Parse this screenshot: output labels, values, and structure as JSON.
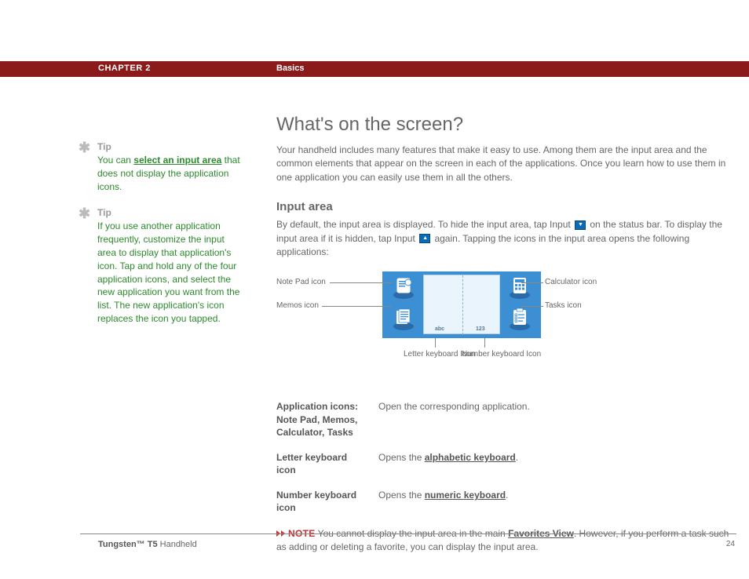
{
  "header": {
    "chapter": "CHAPTER 2",
    "section": "Basics"
  },
  "sidebar": {
    "tips": [
      {
        "label": "Tip",
        "pre": "You can ",
        "link": "select an input area",
        "post": " that does not display the application icons."
      },
      {
        "label": "Tip",
        "pre": "If you use another application frequently, customize the input area to display that application's icon. Tap and hold any of the four application icons, and select the new application you want from the list. The new application's icon replaces the icon you tapped.",
        "link": "",
        "post": ""
      }
    ]
  },
  "main": {
    "title": "What's on the screen?",
    "intro": "Your handheld includes many features that make it easy to use. Among them are the input area and the common elements that appear on the screen in each of the applications. Once you learn how to use them in one application you can easily use them in all the others.",
    "subtitle": "Input area",
    "input_para_a": "By default, the input area is displayed. To hide the input area, tap Input ",
    "input_para_b": " on the status bar. To display the input area if it is hidden, tap Input ",
    "input_para_c": " again. Tapping the icons in the input area opens the following applications:",
    "diagram": {
      "notepad": "Note Pad icon",
      "memos": "Memos icon",
      "calculator": "Calculator icon",
      "tasks": "Tasks icon",
      "letter_kb": "Letter keyboard Icon",
      "number_kb": "Number keyboard Icon",
      "abc": "abc",
      "num": "123"
    },
    "defs": [
      {
        "term": "Application icons: Note Pad, Memos, Calculator, Tasks",
        "desc_pre": "Open the corresponding application.",
        "link": "",
        "desc_post": ""
      },
      {
        "term": "Letter keyboard icon",
        "desc_pre": "Opens the ",
        "link": "alphabetic keyboard",
        "desc_post": "."
      },
      {
        "term": "Number keyboard icon",
        "desc_pre": "Opens the ",
        "link": "numeric keyboard",
        "desc_post": "."
      }
    ],
    "note": {
      "label": "NOTE",
      "pre": " You cannot display the input area in the main ",
      "link": "Favorites View",
      "post": ". However, if you perform a task such as adding or deleting a favorite, you can display the input area."
    }
  },
  "footer": {
    "product_bold": "Tungsten™ T5",
    "product_rest": " Handheld",
    "page": "24"
  }
}
